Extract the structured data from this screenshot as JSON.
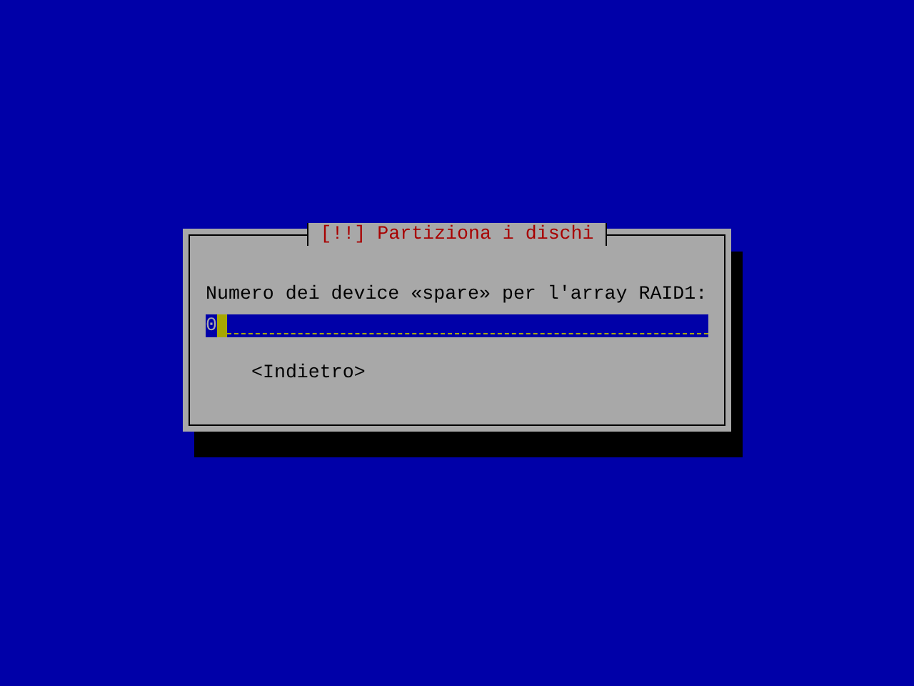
{
  "dialog": {
    "title": "[!!] Partiziona i dischi",
    "prompt": "Numero dei device «spare» per l'array RAID1:",
    "input": {
      "value": "0"
    },
    "buttons": [
      {
        "label": "<Indietro>",
        "selected": false
      }
    ]
  }
}
